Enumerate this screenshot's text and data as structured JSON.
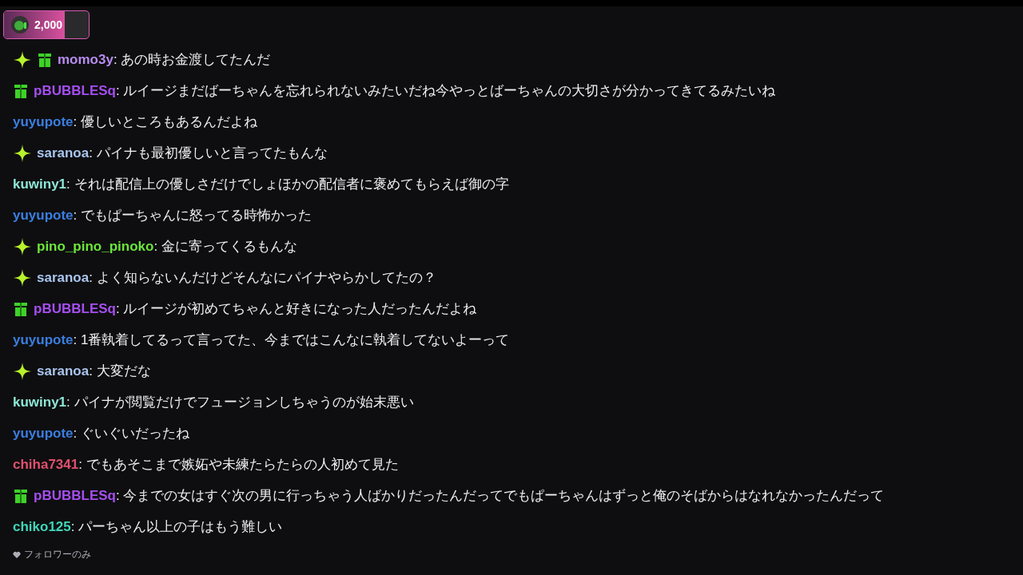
{
  "points_badge": {
    "amount": "2,000",
    "level": 0.72
  },
  "messages": [
    {
      "badges": [
        {
          "kind": "sparkle"
        },
        {
          "kind": "gift"
        }
      ],
      "user": "momo3y",
      "color": "#b98cf0",
      "text": ": あの時お金渡してたんだ"
    },
    {
      "badges": [
        {
          "kind": "gift"
        }
      ],
      "user": "pBUBBLESq",
      "color": "#a64ff0",
      "text": ": ルイージまだばーちゃんを忘れられないみたいだね今やっとばーちゃんの大切さが分かってきてるみたいね"
    },
    {
      "user": "yuyupote",
      "color": "#3b7ee0",
      "text": ": 優しいところもあるんだよね"
    },
    {
      "badges": [
        {
          "kind": "sparkle"
        }
      ],
      "user": "saranoa",
      "color": "#a9c6ee",
      "text": ": パイナも最初優しいと言ってたもんな"
    },
    {
      "user": "kuwiny1",
      "color": "#8ee6d6",
      "text": ": それは配信上の優しさだけでしょほかの配信者に褒めてもらえば御の字"
    },
    {
      "user": "yuyupote",
      "color": "#3b7ee0",
      "text": ": でもぱーちゃんに怒ってる時怖かった"
    },
    {
      "badges": [
        {
          "kind": "sparkle"
        }
      ],
      "user": "pino_pino_pinoko",
      "color": "#6be63a",
      "text": ": 金に寄ってくるもんな"
    },
    {
      "badges": [
        {
          "kind": "sparkle"
        }
      ],
      "user": "saranoa",
      "color": "#a9c6ee",
      "text": ": よく知らないんだけどそんなにパイナやらかしてたの？"
    },
    {
      "badges": [
        {
          "kind": "gift"
        }
      ],
      "user": "pBUBBLESq",
      "color": "#a64ff0",
      "text": ": ルイージが初めてちゃんと好きになった人だったんだよね"
    },
    {
      "user": "yuyupote",
      "color": "#3b7ee0",
      "text": ": 1番執着してるって言ってた、今まではこんなに執着してないよーって"
    },
    {
      "badges": [
        {
          "kind": "sparkle"
        }
      ],
      "user": "saranoa",
      "color": "#a9c6ee",
      "text": ": 大変だな"
    },
    {
      "user": "kuwiny1",
      "color": "#8ee6d6",
      "text": ": パイナが閲覧だけでフュージョンしちゃうのが始末悪い"
    },
    {
      "user": "yuyupote",
      "color": "#3b7ee0",
      "text": ": ぐいぐいだったね"
    },
    {
      "user": "chiha7341",
      "color": "#e0506e",
      "text": ": でもあそこまで嫉妬や未練たらたらの人初めて見た"
    },
    {
      "badges": [
        {
          "kind": "gift"
        }
      ],
      "user": "pBUBBLESq",
      "color": "#a64ff0",
      "text": ": 今までの女はすぐ次の男に行っちゃう人ばかりだったんだってでもぱーちゃんはずっと俺のそばからはなれなかったんだって"
    },
    {
      "user": "chiko125",
      "color": "#3fd6b8",
      "text": ": パーちゃん以上の子はもう難しい"
    }
  ],
  "footer": {
    "text": "フォロワーのみ"
  }
}
